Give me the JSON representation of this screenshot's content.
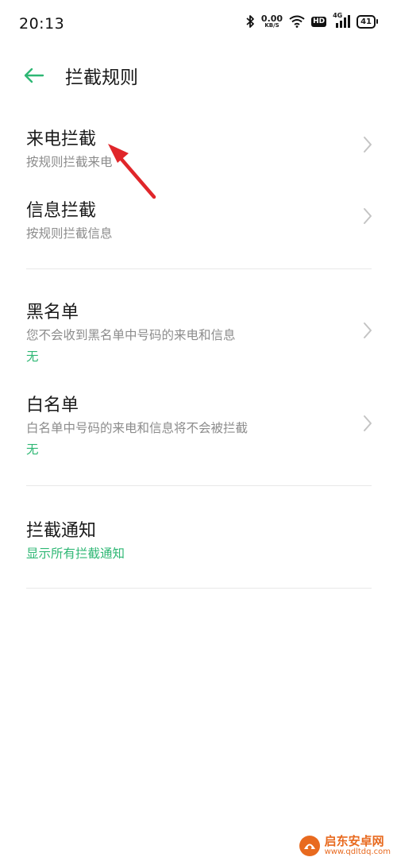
{
  "status_bar": {
    "time": "20:13",
    "net_speed": "0.00",
    "net_unit": "KB/S",
    "hd": "HD",
    "network": "4G",
    "battery": "41"
  },
  "header": {
    "title": "拦截规则"
  },
  "items": [
    {
      "title": "来电拦截",
      "subtitle": "按规则拦截来电"
    },
    {
      "title": "信息拦截",
      "subtitle": "按规则拦截信息"
    },
    {
      "title": "黑名单",
      "subtitle": "您不会收到黑名单中号码的来电和信息",
      "value": "无"
    },
    {
      "title": "白名单",
      "subtitle": "白名单中号码的来电和信息将不会被拦截",
      "value": "无"
    },
    {
      "title": "拦截通知",
      "value": "显示所有拦截通知"
    }
  ],
  "watermark": {
    "name": "启东安卓网",
    "url": "www.qdltdq.com"
  },
  "colors": {
    "accent": "#2eb774",
    "annotation": "#e0262a",
    "watermark": "#e86a1f"
  }
}
